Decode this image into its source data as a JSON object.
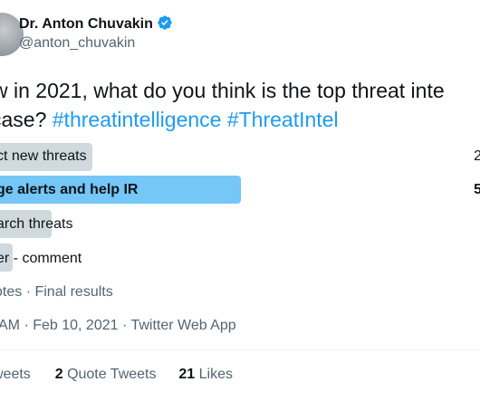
{
  "author": {
    "name": "Dr. Anton Chuvakin",
    "handle": "@anton_chuvakin",
    "verified_icon": "verified-badge-icon"
  },
  "tweet": {
    "line1": "w in 2021, what do you think is the top threat inte",
    "line2_prefix": "case? ",
    "hashtags": [
      "#threatintelligence",
      "#ThreatIntel"
    ]
  },
  "poll": {
    "options": [
      {
        "label": "ct new threats",
        "percent_text": "2",
        "percent": 23,
        "leading": false
      },
      {
        "label": "ge alerts and help IR",
        "percent_text": "5",
        "percent": 55,
        "leading": true
      },
      {
        "label": "arch threats",
        "percent_text": "",
        "percent": 12,
        "leading": false
      },
      {
        "label": "er - comment",
        "percent_text": "",
        "percent": 3,
        "leading": false
      }
    ],
    "summary": "otes · Final results"
  },
  "meta": "AM · Feb 10, 2021 · Twitter Web App",
  "stats": {
    "retweets_label": "weets",
    "quote_count": "2",
    "quote_label": "Quote Tweets",
    "likes_count": "21",
    "likes_label": "Likes"
  },
  "colors": {
    "text": "#0f1419",
    "secondary": "#536471",
    "link": "#1d9bf0",
    "bar_leading": "#74c7f7",
    "bar_other": "#cfd9de"
  }
}
